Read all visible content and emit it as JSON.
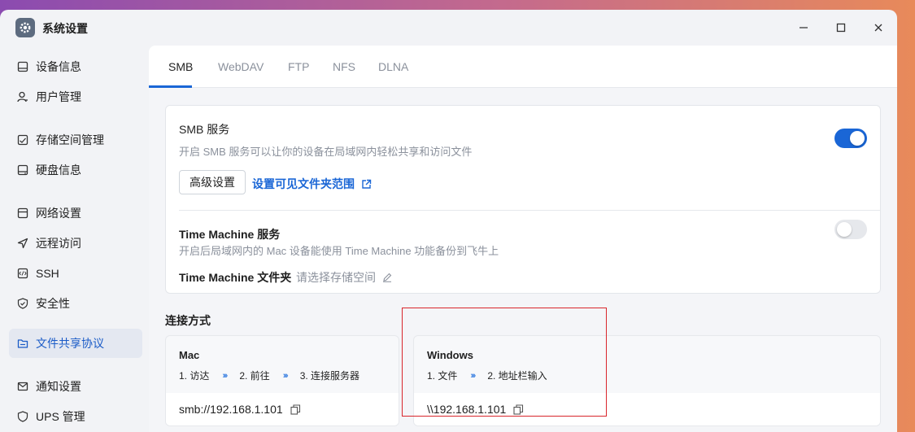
{
  "window": {
    "title": "系统设置",
    "controls": {
      "minimize": "—",
      "maximize": "☐",
      "close": "✕"
    }
  },
  "sidebar": {
    "items": [
      {
        "label": "设备信息",
        "icon": "device-icon"
      },
      {
        "label": "用户管理",
        "icon": "user-icon"
      },
      {
        "label": "存储空间管理",
        "icon": "storage-icon"
      },
      {
        "label": "硬盘信息",
        "icon": "disk-icon"
      },
      {
        "label": "网络设置",
        "icon": "network-icon"
      },
      {
        "label": "远程访问",
        "icon": "remote-icon"
      },
      {
        "label": "SSH",
        "icon": "ssh-icon"
      },
      {
        "label": "安全性",
        "icon": "shield-icon"
      },
      {
        "label": "文件共享协议",
        "icon": "file-share-icon",
        "active": true
      },
      {
        "label": "通知设置",
        "icon": "mail-icon"
      },
      {
        "label": "UPS 管理",
        "icon": "ups-icon"
      }
    ]
  },
  "tabs": [
    "SMB",
    "WebDAV",
    "FTP",
    "NFS",
    "DLNA"
  ],
  "smb": {
    "title": "SMB 服务",
    "desc": "开启 SMB 服务可以让你的设备在局域网内轻松共享和访问文件",
    "enabled": true,
    "advanced_button": "高级设置",
    "visible_scope_link": "设置可见文件夹范围"
  },
  "time_machine": {
    "title": "Time Machine 服务",
    "desc": "开启后局域网内的 Mac 设备能使用 Time Machine 功能备份到飞牛上",
    "enabled": false,
    "folder_label": "Time Machine 文件夹",
    "folder_placeholder": "请选择存储空间"
  },
  "connection": {
    "heading": "连接方式",
    "mac": {
      "title": "Mac",
      "steps": [
        "1. 访达",
        "2. 前往",
        "3. 连接服务器"
      ],
      "address": "smb://192.168.1.101"
    },
    "windows": {
      "title": "Windows",
      "steps": [
        "1. 文件",
        "2. 地址栏输入"
      ],
      "address": "\\\\192.168.1.101"
    }
  },
  "colors": {
    "accent": "#1a66d6",
    "highlight_box": "#d9262c"
  }
}
